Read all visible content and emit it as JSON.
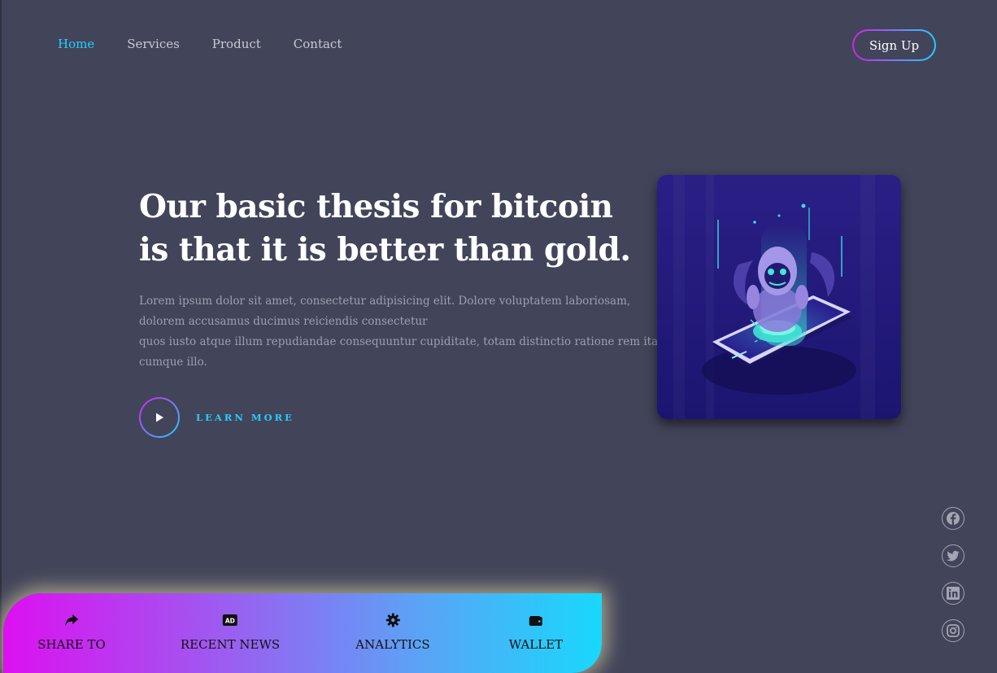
{
  "nav": {
    "items": [
      {
        "label": "Home",
        "active": true
      },
      {
        "label": "Services",
        "active": false
      },
      {
        "label": "Product",
        "active": false
      },
      {
        "label": "Contact",
        "active": false
      }
    ],
    "signup_label": "Sign Up"
  },
  "hero": {
    "title_line1": "Our basic thesis for bitcoin",
    "title_line2": "is that it is better than gold.",
    "body_lines": [
      "Lorem ipsum dolor sit amet, consectetur adipisicing elit. Dolore voluptatem laboriosam,",
      "dolorem accusamus ducimus reiciendis consectetur",
      "quos iusto atque illum repudiandae consequuntur cupiditate, totam distinctio ratione rem itaque",
      "cumque illo."
    ],
    "cta_label": "LEARN MORE",
    "illustration_icon": "robot-on-phone-illustration"
  },
  "socials": [
    "facebook-icon",
    "twitter-icon",
    "linkedin-icon",
    "instagram-icon"
  ],
  "bottom_bar": {
    "items": [
      {
        "label": "SHARE TO",
        "icon": "share-icon"
      },
      {
        "label": "RECENT NEWS",
        "icon": "ad-icon"
      },
      {
        "label": "ANALYTICS",
        "icon": "gear-icon"
      },
      {
        "label": "WALLET",
        "icon": "wallet-icon"
      }
    ]
  },
  "colors": {
    "background": "#42445a",
    "accent": "#22cfff",
    "gradient_start": "#d41fe8",
    "gradient_end": "#1fd1ff"
  }
}
